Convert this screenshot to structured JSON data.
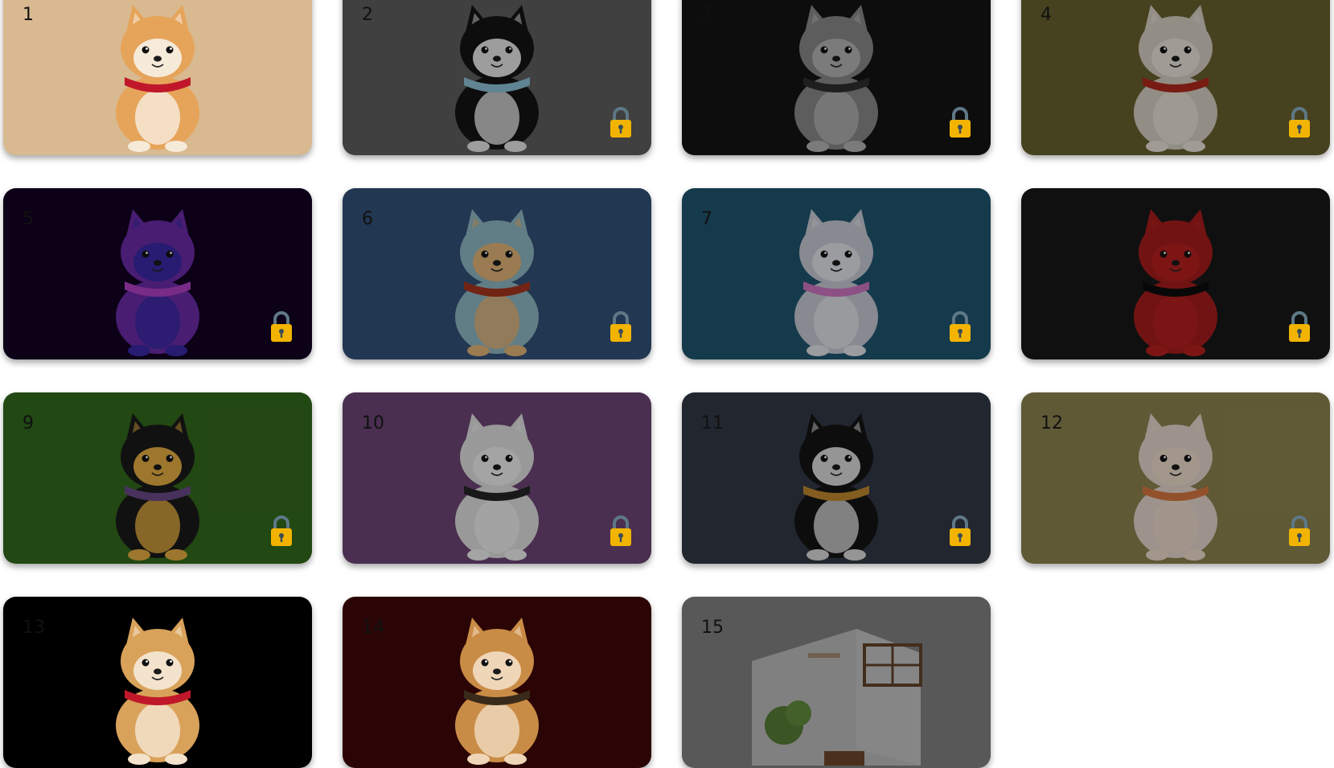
{
  "cards": [
    {
      "num": "1",
      "bg": "#d8b990",
      "locked": false,
      "fur": "#e6a45a",
      "accent": "#c0182a",
      "face": "#f6ead8"
    },
    {
      "num": "2",
      "bg": "#5f5f5f",
      "locked": true,
      "fur": "#141414",
      "accent": "#8ec3d6",
      "face": "#e8e8e8"
    },
    {
      "num": "3",
      "bg": "#141414",
      "locked": true,
      "fur": "#8a8a8a",
      "accent": "#2e2e2e",
      "face": "#b5b5b5"
    },
    {
      "num": "4",
      "bg": "#68612f",
      "locked": true,
      "fur": "#d8d0c4",
      "accent": "#b22a1c",
      "face": "#ece6dc"
    },
    {
      "num": "5",
      "bg": "#120222",
      "locked": true,
      "fur": "#6a2ca8",
      "accent": "#b240c8",
      "face": "#3a2aa8"
    },
    {
      "num": "6",
      "bg": "#33527a",
      "locked": true,
      "fur": "#8fb8c4",
      "accent": "#a8351e",
      "face": "#e3b57a"
    },
    {
      "num": "7",
      "bg": "#1f566f",
      "locked": true,
      "fur": "#c9ccd6",
      "accent": "#d076c4",
      "face": "#e4e6ec"
    },
    {
      "num": "8",
      "bg": "#181818",
      "locked": true,
      "fur": "#a81c1c",
      "accent": "#0d0d0d",
      "face": "#b81f1f"
    },
    {
      "num": "9",
      "bg": "#336a1c",
      "locked": true,
      "fur": "#1a1a1a",
      "accent": "#6a4b8a",
      "face": "#e8b043"
    },
    {
      "num": "10",
      "bg": "#6e4677",
      "locked": true,
      "fur": "#e2e2e2",
      "accent": "#262626",
      "face": "#f2f2f2"
    },
    {
      "num": "11",
      "bg": "#323846",
      "locked": true,
      "fur": "#141414",
      "accent": "#c28a2e",
      "face": "#dcdcdc"
    },
    {
      "num": "12",
      "bg": "#8d8450",
      "locked": true,
      "fur": "#e9d8d0",
      "accent": "#d77840",
      "face": "#f0dfcf"
    },
    {
      "num": "13",
      "bg": "#000000",
      "locked": false,
      "fur": "#d9a25a",
      "accent": "#c0182a",
      "face": "#f3e3cc"
    },
    {
      "num": "14",
      "bg": "#2b0505",
      "locked": false,
      "fur": "#c98c46",
      "accent": "#3a2a1a",
      "face": "#f0d6b8"
    },
    {
      "num": "15",
      "bg": "#8e8e8e",
      "locked": false,
      "scene": true
    }
  ],
  "colors": {
    "lock_body": "#f2b400",
    "lock_shackle": "#5e7886",
    "lock_keyhole": "#3c4c56"
  }
}
